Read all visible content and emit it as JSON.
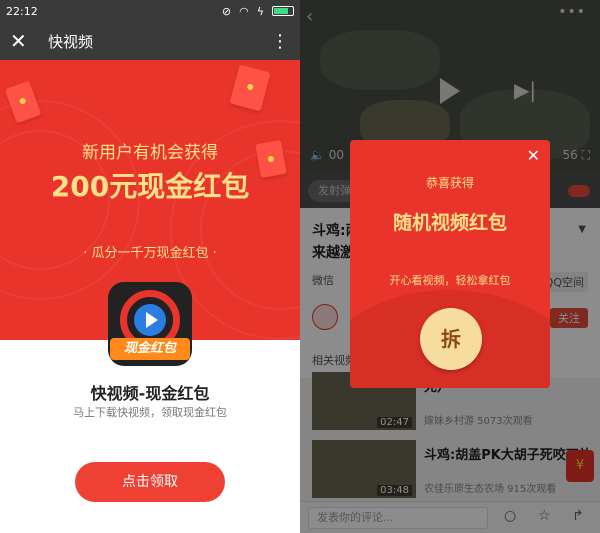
{
  "left": {
    "status": {
      "time": "22:12"
    },
    "toolbar": {
      "title": "快视频"
    },
    "banner": {
      "line1": "新用户有机会获得",
      "line2": "200元现金红包",
      "line3": "· 瓜分一千万现金红包 ·"
    },
    "app": {
      "icon_tag": "现金红包",
      "name": "快视频-现金红包",
      "desc": "马上下载快视频，领取现金红包"
    },
    "claim_button": "点击领取"
  },
  "right": {
    "video": {
      "time_left": "00",
      "time_right": "56"
    },
    "danmu_placeholder": "发射弹",
    "title_partial": "斗鸡:两",
    "title_partial2": "来越激",
    "share_wechat": "微信",
    "share_qq": "QQ空间",
    "follow": "关注",
    "related_header": "相关视频",
    "related": [
      {
        "title": "死）",
        "duration": "02:47",
        "meta": "嫁妹乡村游  5073次观看"
      },
      {
        "title": "斗鸡:胡盖PK大胡子死咬不放",
        "duration": "03:48",
        "meta": "农佳乐原生态农场  915次观看"
      }
    ],
    "comment_placeholder": "发表你的评论...",
    "modal": {
      "line1": "恭喜获得",
      "line2": "随机视频红包",
      "line3": "开心看视频，轻松拿红包",
      "open_button": "拆"
    },
    "float_badge": "¥"
  },
  "colors": {
    "brand_red": "#e9342c",
    "gold_text": "#ffe18a",
    "button_red": "#ee4134"
  }
}
